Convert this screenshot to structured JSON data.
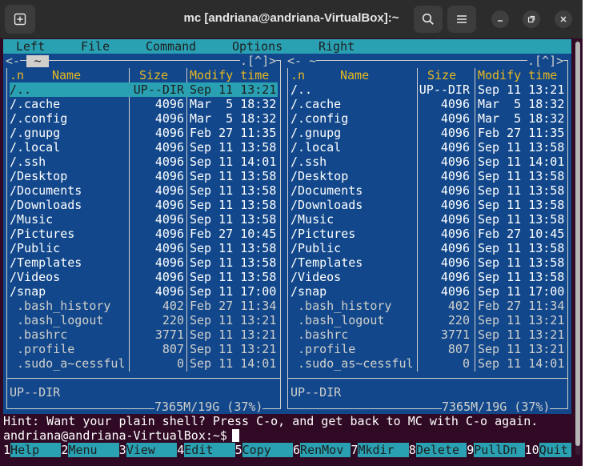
{
  "window": {
    "title": "mc [andriana@andriana-VirtualBox]:~"
  },
  "menubar": [
    "Left",
    "File",
    "Command",
    "Options",
    "Right"
  ],
  "left_panel": {
    "dir_tab": "~",
    "top_right_marker": ".[^]>",
    "top_left_marker": "<-",
    "headers": {
      "n": ".n",
      "name": "Name",
      "size": "Size",
      "modify": "Modify time"
    },
    "rows": [
      {
        "name": "/..",
        "size": "UP--DIR",
        "time": "Sep 11 13:21",
        "selected": true,
        "dir": true
      },
      {
        "name": "/.cache",
        "size": "4096",
        "time": "Mar  5 18:32",
        "dir": true
      },
      {
        "name": "/.config",
        "size": "4096",
        "time": "Mar  5 18:32",
        "dir": true
      },
      {
        "name": "/.gnupg",
        "size": "4096",
        "time": "Feb 27 11:35",
        "dir": true
      },
      {
        "name": "/.local",
        "size": "4096",
        "time": "Sep 11 13:58",
        "dir": true
      },
      {
        "name": "/.ssh",
        "size": "4096",
        "time": "Sep 11 14:01",
        "dir": true
      },
      {
        "name": "/Desktop",
        "size": "4096",
        "time": "Sep 11 13:58",
        "dir": true
      },
      {
        "name": "/Documents",
        "size": "4096",
        "time": "Sep 11 13:58",
        "dir": true
      },
      {
        "name": "/Downloads",
        "size": "4096",
        "time": "Sep 11 13:58",
        "dir": true
      },
      {
        "name": "/Music",
        "size": "4096",
        "time": "Sep 11 13:58",
        "dir": true
      },
      {
        "name": "/Pictures",
        "size": "4096",
        "time": "Feb 27 10:45",
        "dir": true
      },
      {
        "name": "/Public",
        "size": "4096",
        "time": "Sep 11 13:58",
        "dir": true
      },
      {
        "name": "/Templates",
        "size": "4096",
        "time": "Sep 11 13:58",
        "dir": true
      },
      {
        "name": "/Videos",
        "size": "4096",
        "time": "Sep 11 13:58",
        "dir": true
      },
      {
        "name": "/snap",
        "size": "4096",
        "time": "Sep 11 17:00",
        "dir": true
      },
      {
        "name": " .bash_history",
        "size": "402",
        "time": "Feb 27 11:34",
        "dir": false
      },
      {
        "name": " .bash_logout",
        "size": "220",
        "time": "Sep 11 13:21",
        "dir": false
      },
      {
        "name": " .bashrc",
        "size": "3771",
        "time": "Sep 11 13:21",
        "dir": false
      },
      {
        "name": " .profile",
        "size": "807",
        "time": "Sep 11 13:21",
        "dir": false
      },
      {
        "name": " .sudo_a~cessful",
        "size": "0",
        "time": "Sep 11 14:01",
        "dir": false
      }
    ],
    "status": "UP--DIR",
    "disk": "7365M/19G (37%)"
  },
  "right_panel": {
    "top_left_marker": "<- ~",
    "top_right_marker": ".[^]>",
    "headers": {
      "n": ".n",
      "name": "Name",
      "size": "Size",
      "modify": "Modify time"
    },
    "rows": [
      {
        "name": "/..",
        "size": "UP--DIR",
        "time": "Sep 11 13:21",
        "dir": true
      },
      {
        "name": "/.cache",
        "size": "4096",
        "time": "Mar  5 18:32",
        "dir": true
      },
      {
        "name": "/.config",
        "size": "4096",
        "time": "Mar  5 18:32",
        "dir": true
      },
      {
        "name": "/.gnupg",
        "size": "4096",
        "time": "Feb 27 11:35",
        "dir": true
      },
      {
        "name": "/.local",
        "size": "4096",
        "time": "Sep 11 13:58",
        "dir": true
      },
      {
        "name": "/.ssh",
        "size": "4096",
        "time": "Sep 11 14:01",
        "dir": true
      },
      {
        "name": "/Desktop",
        "size": "4096",
        "time": "Sep 11 13:58",
        "dir": true
      },
      {
        "name": "/Documents",
        "size": "4096",
        "time": "Sep 11 13:58",
        "dir": true
      },
      {
        "name": "/Downloads",
        "size": "4096",
        "time": "Sep 11 13:58",
        "dir": true
      },
      {
        "name": "/Music",
        "size": "4096",
        "time": "Sep 11 13:58",
        "dir": true
      },
      {
        "name": "/Pictures",
        "size": "4096",
        "time": "Feb 27 10:45",
        "dir": true
      },
      {
        "name": "/Public",
        "size": "4096",
        "time": "Sep 11 13:58",
        "dir": true
      },
      {
        "name": "/Templates",
        "size": "4096",
        "time": "Sep 11 13:58",
        "dir": true
      },
      {
        "name": "/Videos",
        "size": "4096",
        "time": "Sep 11 13:58",
        "dir": true
      },
      {
        "name": "/snap",
        "size": "4096",
        "time": "Sep 11 17:00",
        "dir": true
      },
      {
        "name": " .bash_history",
        "size": "402",
        "time": "Feb 27 11:34",
        "dir": false
      },
      {
        "name": " .bash_logout",
        "size": "220",
        "time": "Sep 11 13:21",
        "dir": false
      },
      {
        "name": " .bashrc",
        "size": "3771",
        "time": "Sep 11 13:21",
        "dir": false
      },
      {
        "name": " .profile",
        "size": "807",
        "time": "Sep 11 13:21",
        "dir": false
      },
      {
        "name": " .sudo_as~cessful",
        "size": "0",
        "time": "Sep 11 14:01",
        "dir": false
      }
    ],
    "status": "UP--DIR",
    "disk": "7365M/19G (37%)"
  },
  "hint": "Hint: Want your plain shell? Press C-o, and get back to MC with C-o again.",
  "prompt": "andriana@andriana-VirtualBox:~$",
  "fkeys": [
    {
      "num": "1",
      "label": "Help"
    },
    {
      "num": "2",
      "label": "Menu"
    },
    {
      "num": "3",
      "label": "View"
    },
    {
      "num": "4",
      "label": "Edit"
    },
    {
      "num": "5",
      "label": "Copy"
    },
    {
      "num": "6",
      "label": "RenMov"
    },
    {
      "num": "7",
      "label": "Mkdir"
    },
    {
      "num": "8",
      "label": "Delete"
    },
    {
      "num": "9",
      "label": "PullDn"
    },
    {
      "num": "10",
      "label": "Quit"
    }
  ],
  "colors": {
    "terminal_bg": "#300a24",
    "panel_bg": "#12488b",
    "accent_cyan": "#2aa1b3",
    "header_yellow": "#e8b820"
  }
}
